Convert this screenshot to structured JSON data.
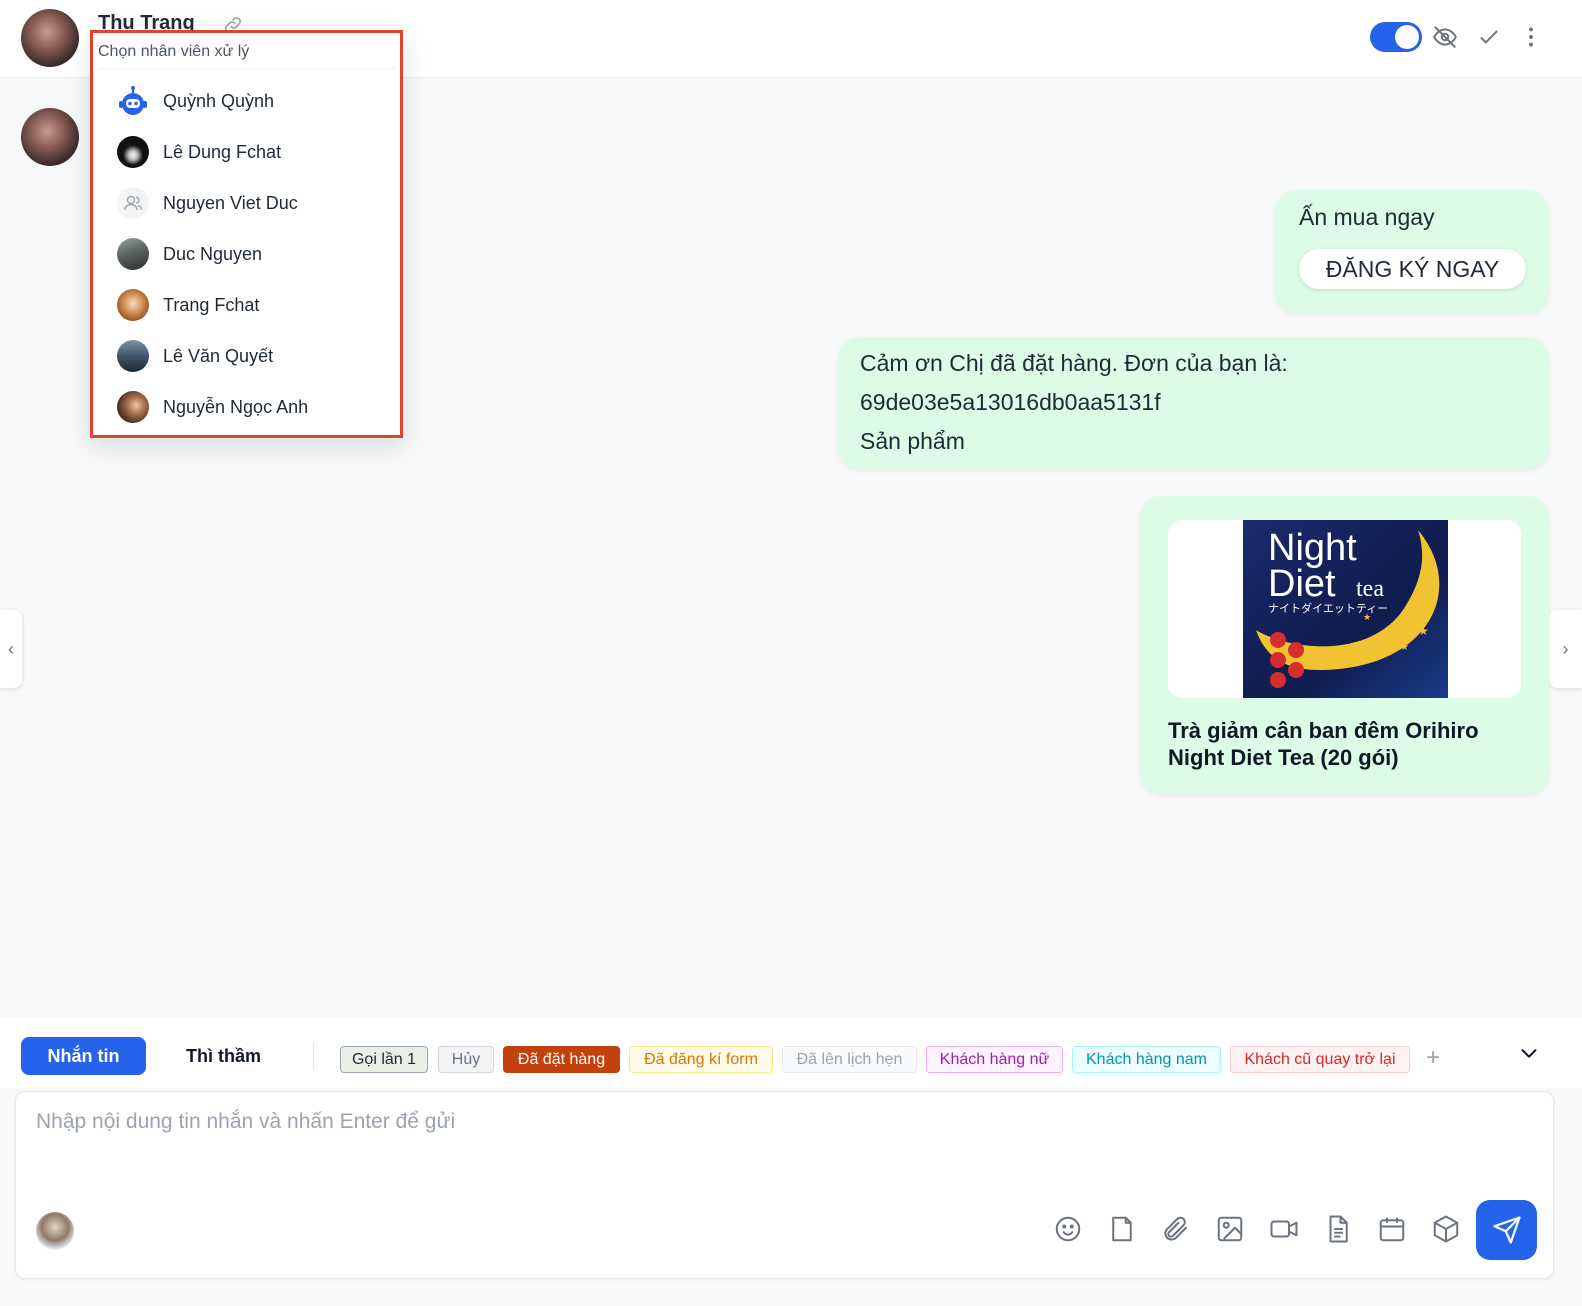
{
  "header": {
    "contact_name": "Thu Trang",
    "toggle_on": true
  },
  "dropdown": {
    "title": "Chọn nhân viên xử lý",
    "items": [
      {
        "name": "Quỳnh Quỳnh",
        "avatar": "robot-icon"
      },
      {
        "name": "Lê Dung Fchat",
        "avatar": "photo"
      },
      {
        "name": "Nguyen Viet Duc",
        "avatar": "user-placeholder-icon"
      },
      {
        "name": "Duc Nguyen",
        "avatar": "photo"
      },
      {
        "name": "Trang Fchat",
        "avatar": "photo"
      },
      {
        "name": "Lê Văn Quyết",
        "avatar": "photo"
      },
      {
        "name": "Nguyễn Ngọc Anh",
        "avatar": "photo"
      }
    ]
  },
  "messages": {
    "m1_text": "Ấn mua ngay",
    "m1_button": "ĐĂNG KÝ NGAY",
    "m2_line1": "Cảm ơn Chị đã đặt hàng. Đơn của bạn là:",
    "m2_line2": "69de03e5a13016db0aa5131f",
    "m2_line3": "Sản phẩm",
    "m3_product_title": "Trà giảm cân ban đêm Orihiro Night Diet Tea (20 gói)",
    "m3_image_text_1": "Night",
    "m3_image_text_2": "Diet",
    "m3_image_text_3": "tea",
    "m3_image_text_4": "ナイトダイエットティー"
  },
  "composer": {
    "tab_message": "Nhắn tin",
    "tab_whisper": "Thì thầm",
    "placeholder": "Nhập nội dung tin nhắn và nhấn Enter để gửi",
    "tags": [
      {
        "label": "Gọi lần 1",
        "color": "#1f2937",
        "bg": "#e9efe4",
        "border": "#9ca3af"
      },
      {
        "label": "Hủy",
        "color": "#6b7280",
        "bg": "#f3f4f6",
        "border": "#d1d5db"
      },
      {
        "label": "Đã đặt hàng",
        "color": "#ffffff",
        "bg": "#c2410c",
        "border": "#c2410c"
      },
      {
        "label": "Đã đăng kí form",
        "color": "#d97706",
        "bg": "#fffbeb",
        "border": "#fde68a"
      },
      {
        "label": "Đã lên lịch hẹn",
        "color": "#9ca3af",
        "bg": "#f9fafb",
        "border": "#e5e7eb"
      },
      {
        "label": "Khách hàng nữ",
        "color": "#a21caf",
        "bg": "#fdf4ff",
        "border": "#f0abfc"
      },
      {
        "label": "Khách hàng nam",
        "color": "#0891b2",
        "bg": "#ecfeff",
        "border": "#a5f3fc"
      },
      {
        "label": "Khách cũ quay trở lại",
        "color": "#dc2626",
        "bg": "#fef2f2",
        "border": "#fecaca"
      }
    ]
  },
  "colors": {
    "accent": "#2563eb",
    "bubble": "#dcfce7",
    "highlight": "#e0442d"
  }
}
